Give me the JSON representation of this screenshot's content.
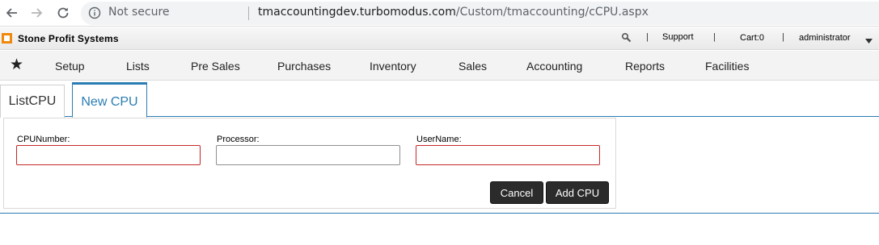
{
  "browser": {
    "security_label": "Not secure",
    "url_host": "tmaccountingdev.turbomodus.com",
    "url_path": "/Custom/tmaccounting/cCPU.aspx"
  },
  "header": {
    "brand": "Stone Profit Systems",
    "brand_color": "#f0880c",
    "separator": "|",
    "support_label": "Support",
    "cart_label": "Cart:0",
    "user_label": "administrator"
  },
  "nav": {
    "items": [
      "Setup",
      "Lists",
      "Pre Sales",
      "Purchases",
      "Inventory",
      "Sales",
      "Accounting",
      "Reports",
      "Facilities"
    ]
  },
  "tabs": [
    {
      "label": "ListCPU",
      "active": false
    },
    {
      "label": "New CPU",
      "active": true
    }
  ],
  "form": {
    "fields": [
      {
        "label": "CPUNumber:",
        "value": "",
        "invalid": true
      },
      {
        "label": "Processor:",
        "value": "",
        "invalid": false
      },
      {
        "label": "UserName:",
        "value": "",
        "invalid": true
      }
    ],
    "cancel_label": "Cancel",
    "add_label": "Add CPU"
  },
  "colors": {
    "accent": "#2a7cb2",
    "invalid_border": "#c62828",
    "button_bg": "#2b2b2b"
  }
}
